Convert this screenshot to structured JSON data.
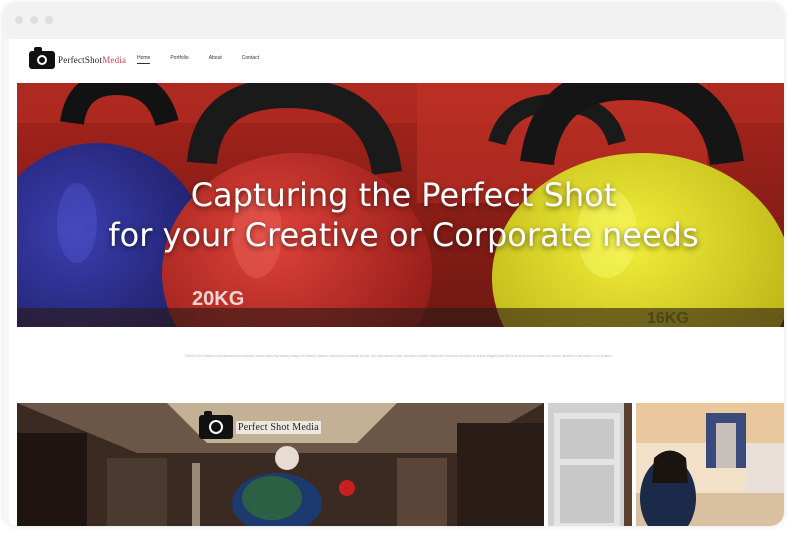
{
  "window": {
    "controls": [
      "close",
      "minimize",
      "maximize"
    ]
  },
  "site": {
    "logo": {
      "icon": "camera-icon",
      "text_main": "PerfectShot",
      "text_accent": "Media"
    },
    "nav": {
      "items": [
        {
          "label": "Home",
          "active": true
        },
        {
          "label": "Portfolio",
          "active": false
        },
        {
          "label": "About",
          "active": false
        },
        {
          "label": "Contact",
          "active": false
        }
      ]
    }
  },
  "hero": {
    "title_line1": "Capturing the Perfect Shot",
    "title_line2": "for your Creative or Corporate needs",
    "image_text": {
      "kettlebell_label": "20KG",
      "kettlebell_label_2": "16KG"
    }
  },
  "intro": {
    "text": "Perfect Shot Media is a professional photography studio capturing striking images for fashion, fitness, events and corporate clients. Our experienced team combines creative vision with technical expertise to deliver imagery that tells your story and elevates your brand, whether in the studio or on location."
  },
  "gallery": {
    "logo_text": "Perfect Shot Media",
    "tiles": [
      "fashion-store",
      "doorway",
      "boutique-portrait"
    ]
  },
  "colors": {
    "accent": "#c9414f",
    "hero_text": "#ffffff",
    "page_bg": "#ffffff"
  }
}
